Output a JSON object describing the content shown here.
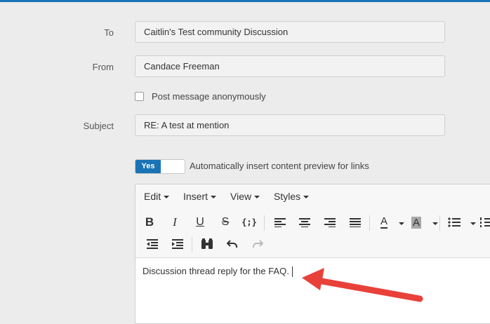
{
  "form": {
    "to_label": "To",
    "to_value": "Caitlin's Test community Discussion",
    "from_label": "From",
    "from_value": "Candace Freeman",
    "anonymous_label": "Post message anonymously",
    "subject_label": "Subject",
    "subject_value": "RE: A test at mention",
    "toggle_state": "Yes",
    "toggle_label": "Automatically insert content preview for links"
  },
  "editor": {
    "menus": [
      "Edit",
      "Insert",
      "View",
      "Styles"
    ],
    "toolbar_icons": [
      "bold-icon",
      "italic-icon",
      "underline-icon",
      "strikethrough-icon",
      "code-braces-icon",
      "align-left-icon",
      "align-center-icon",
      "align-right-icon",
      "align-justify-icon",
      "text-color-icon",
      "highlight-color-icon",
      "bullet-list-icon",
      "numbered-list-icon",
      "outdent-icon",
      "indent-icon",
      "find-binoculars-icon",
      "undo-icon",
      "redo-icon"
    ],
    "body_text": "Discussion thread reply for the FAQ."
  },
  "colors": {
    "accent": "#1a73b5",
    "arrow": "#e8413a"
  }
}
